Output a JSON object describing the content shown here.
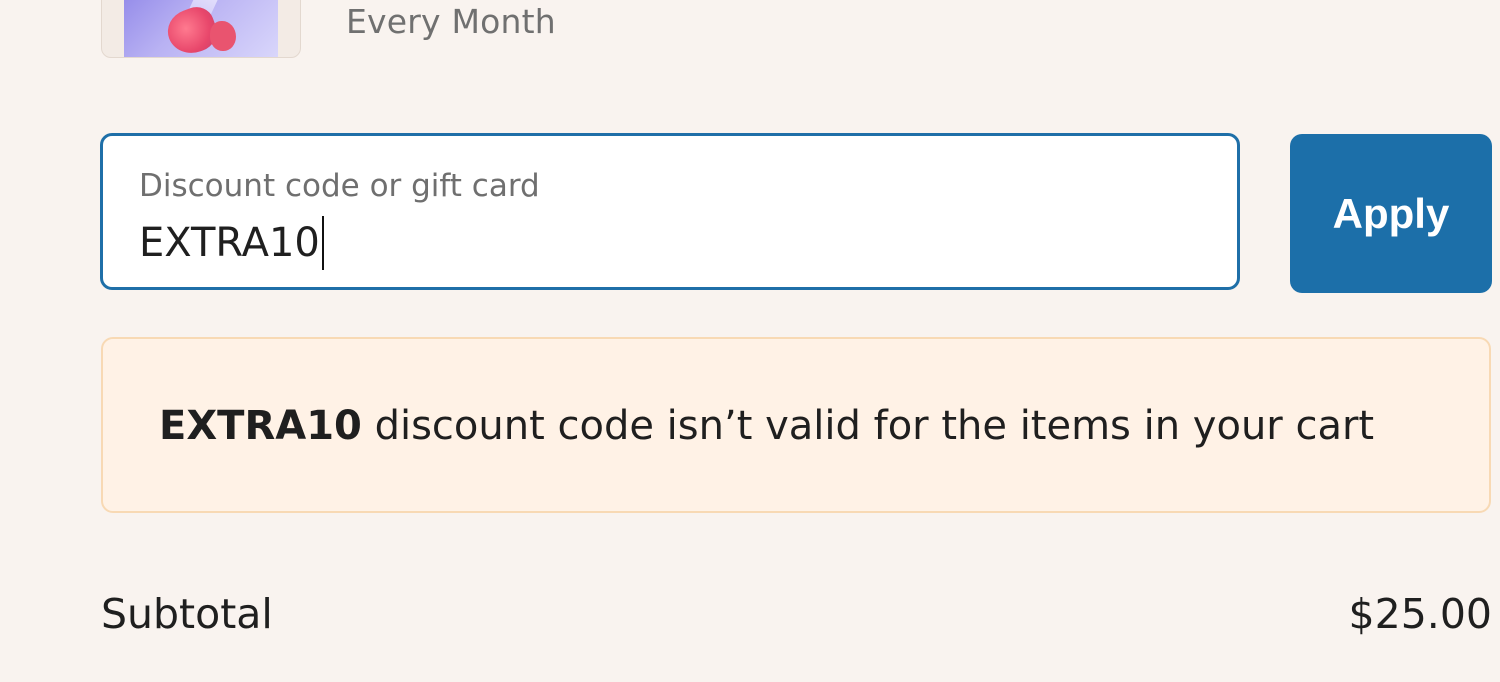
{
  "product": {
    "frequency": "Every Month"
  },
  "discount": {
    "label": "Discount code or gift card",
    "value": "EXTRA10",
    "apply_label": "Apply"
  },
  "warning": {
    "code": "EXTRA10",
    "message": " discount code isn’t valid for the items in your cart"
  },
  "summary": {
    "subtotal_label": "Subtotal",
    "subtotal_value": "$25.00"
  },
  "colors": {
    "background": "#f9f3ef",
    "accent": "#1c6fa9",
    "warning_bg": "#fff2e6",
    "warning_border": "#f8d9b4"
  }
}
